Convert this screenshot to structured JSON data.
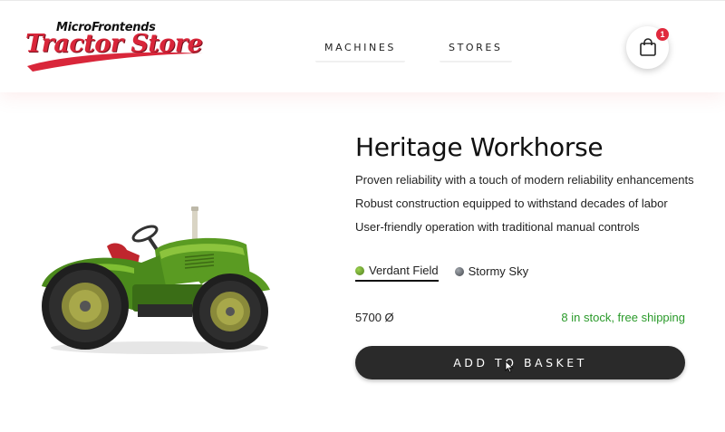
{
  "brand": {
    "logo_top": "MicroFrontends",
    "logo_main": "Tractor Store",
    "colors": {
      "primary": "#d9263a",
      "dark": "#2a2a2a",
      "stock": "#2a9a2a"
    }
  },
  "nav": {
    "items": [
      {
        "label": "MACHINES"
      },
      {
        "label": "STORES"
      }
    ]
  },
  "cart": {
    "icon": "shopping-bag-icon",
    "count": "1"
  },
  "product": {
    "title": "Heritage Workhorse",
    "features": [
      "Proven reliability with a touch of modern reliability enhancements",
      "Robust construction equipped to withstand decades of labor",
      "User-friendly operation with traditional manual controls"
    ],
    "variants": [
      {
        "label": "Verdant Field",
        "color": "#5e8f2a",
        "selected": true
      },
      {
        "label": "Stormy Sky",
        "color": "#5a5f66",
        "selected": false
      }
    ],
    "price": "5700 Ø",
    "stock": "8 in stock, free shipping",
    "add_to_basket": "ADD TO BASKET",
    "image": {
      "subject": "green vintage tractor"
    }
  }
}
